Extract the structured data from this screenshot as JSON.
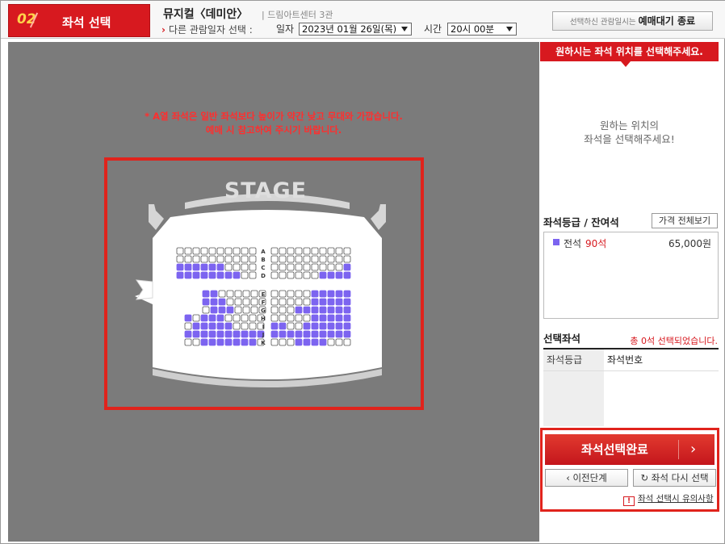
{
  "step": {
    "number": "02",
    "title": "좌석 선택"
  },
  "show": {
    "title": "뮤지컬〈데미안〉",
    "venue": "| 드림아트센터 3관"
  },
  "schedule": {
    "select_label": "다른 관람일자 선택 :",
    "date_label": "일자",
    "date_value": "2023년 01월 26일(목)",
    "time_label": "시간",
    "time_value": "20시 00분"
  },
  "header_button": {
    "prefix": "선택하신 관람일시는",
    "label": "예매대기 종료"
  },
  "seatmap": {
    "notice_line1": "* A열 좌석은 일반 좌석보다 높이가 약간 낮고 무대와 가깝습니다.",
    "notice_line2": "예매 시 참고하여 주시기 바랍니다.",
    "stage_label": "STAGE",
    "rows_front": [
      "A",
      "B",
      "C",
      "D"
    ],
    "rows_back": [
      "E",
      "F",
      "G",
      "H",
      "I",
      "J",
      "K"
    ]
  },
  "panel": {
    "top_banner": "원하시는 좌석 위치를 선택해주세요.",
    "message_line1": "원하는 위치의",
    "message_line2": "좌석을 선택해주세요!",
    "grade_title": "좌석등급 / 잔여석",
    "price_button": "가격 전체보기",
    "grade": {
      "name": "전석",
      "remaining": "90석",
      "price": "65,000원",
      "color": "#7c64f0"
    },
    "selected_title": "선택좌석",
    "selected_count": "총 0석 선택되었습니다.",
    "col_grade": "좌석등급",
    "col_number": "좌석번호",
    "complete_button": "좌석선택완료",
    "prev_button": "이전단계",
    "reset_button": "좌석 다시 선택",
    "caution_text": "좌석 선택시 유의사항"
  },
  "colors": {
    "brand_red": "#d7191f",
    "available_seat": "#7c64f0",
    "map_background": "#7b7b7b"
  },
  "icons": {
    "prev": "chevron-left-icon",
    "reset": "refresh-icon",
    "caution": "warning-icon",
    "next": "chevron-right-icon"
  }
}
